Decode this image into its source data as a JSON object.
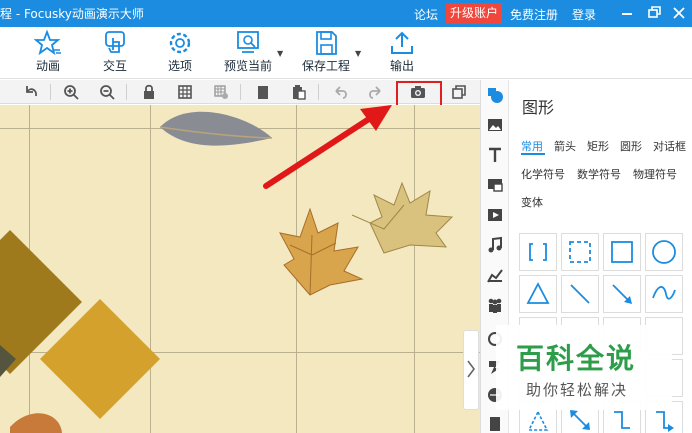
{
  "title_bar": {
    "title": "程 - Focusky动画演示大师",
    "links": {
      "forum": "论坛",
      "upgrade": "升级账户",
      "register": "免费注册",
      "login": "登录"
    },
    "colors": {
      "bar": "#1b8ce0",
      "upgrade": "#f0463c"
    }
  },
  "toolbar": {
    "items": [
      {
        "label": "动画",
        "icon": "star-animation-icon"
      },
      {
        "label": "交互",
        "icon": "hand-pointer-icon"
      },
      {
        "label": "选项",
        "icon": "gear-icon"
      },
      {
        "label": "预览当前",
        "icon": "preview-icon"
      },
      {
        "label": "保存工程",
        "icon": "save-icon"
      },
      {
        "label": "输出",
        "icon": "upload-icon"
      }
    ]
  },
  "subbar": {
    "icons": [
      "undo-rotate-icon",
      "zoom-in-icon",
      "zoom-out-icon",
      "lock-icon",
      "grid-icon",
      "grid-settings-icon",
      "copy-icon",
      "paste-icon",
      "undo-icon",
      "redo-icon",
      "camera-icon",
      "frame-icon"
    ]
  },
  "right_panel": {
    "title": "图形",
    "categories_row1": [
      "常用",
      "箭头",
      "矩形",
      "圆形",
      "对话框"
    ],
    "categories_row2": [
      "化学符号",
      "数学符号",
      "物理符号"
    ],
    "categories_row3": [
      "变体"
    ],
    "active_category": "常用",
    "side_icons": [
      "shape-icon",
      "image-icon",
      "text-icon",
      "media-icon",
      "video-icon",
      "music-icon",
      "chart-icon",
      "people-icon",
      "link-icon",
      "plugin-icon",
      "globe-icon",
      "bookmark-icon"
    ],
    "shapes": [
      "brackets-shape",
      "dashed-square-shape",
      "square-shape",
      "circle-shape",
      "triangle-shape",
      "line-shape",
      "arrow-line-shape",
      "curve-shape"
    ]
  },
  "watermark": {
    "main": "百科全说",
    "sub": "助你轻松解决"
  }
}
